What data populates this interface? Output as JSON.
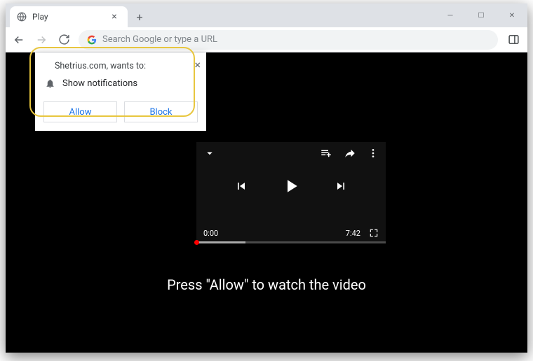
{
  "browser": {
    "tab_title": "Play",
    "omnibox_placeholder": "Search Google or type a URL"
  },
  "notification": {
    "site": "Shetrius.com",
    "wants_to": "wants to:",
    "permission": "Show notifications",
    "allow": "Allow",
    "block": "Block"
  },
  "player": {
    "current_time": "0:00",
    "duration": "7:42"
  },
  "page": {
    "prompt": "Press \"Allow\" to watch the video"
  }
}
